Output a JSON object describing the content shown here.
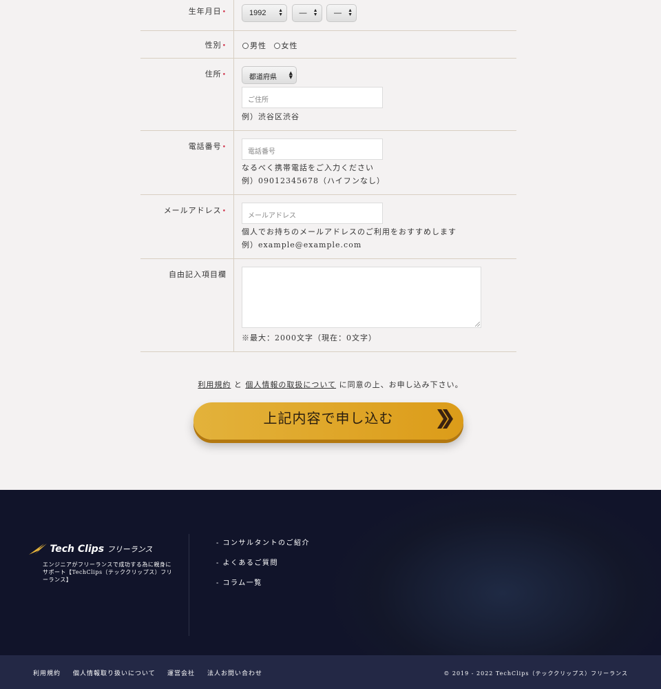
{
  "form": {
    "birthday": {
      "label": "生年月日",
      "year": "1992",
      "month": "—",
      "day": "—"
    },
    "gender": {
      "label": "性別",
      "options": [
        "男性",
        "女性"
      ]
    },
    "address": {
      "label": "住所",
      "prefecture": "都道府県",
      "placeholder": "ご住所",
      "example": "例）渋谷区渋谷"
    },
    "phone": {
      "label": "電話番号",
      "placeholder": "電話番号",
      "note": "なるべく携帯電話をご入力ください",
      "example": "例）09012345678（ハイフンなし）"
    },
    "email": {
      "label": "メールアドレス",
      "placeholder": "メールアドレス",
      "note": "個人でお持ちのメールアドレスのご利用をおすすめします",
      "example": "例）example@example.com"
    },
    "free": {
      "label": "自由記入項目欄",
      "counter": "※最大：2000文字（現在：0文字）"
    },
    "required_mark": "•"
  },
  "agreement": {
    "terms": "利用規約",
    "and": "と",
    "privacy": "個人情報の取扱について",
    "rest": "に同意の上、お申し込み下さい。"
  },
  "submit": {
    "label": "上記内容で申し込む"
  },
  "footer": {
    "logo_text": "Tech Clips",
    "logo_sub": "フリーランス",
    "description": "エンジニアがフリーランスで成功する為に親身にサポート【TechClips（テッククリップス）フリーランス】",
    "links": [
      "- コンサルタントのご紹介",
      "- よくあるご質問",
      "- コラム一覧"
    ]
  },
  "bottom": {
    "links": [
      "利用規約",
      "個人情報取り扱いについて",
      "運営会社",
      "法人お問い合わせ"
    ],
    "copyright": "© 2019 - 2022 TechClips（テッククリップス）フリーランス"
  },
  "colors": {
    "accent": "#dc9c19",
    "required": "#d0334b",
    "footer_bg": "#131729",
    "bottom_bg": "#232845"
  }
}
